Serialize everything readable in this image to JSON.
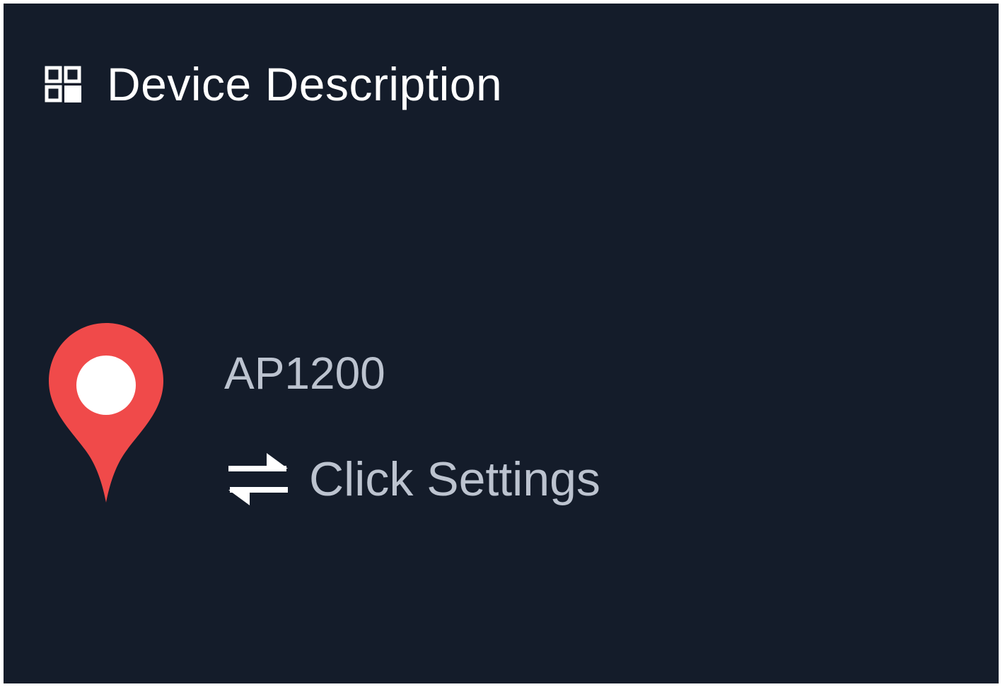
{
  "header": {
    "icon": "grid-icon",
    "title": "Device Description"
  },
  "device": {
    "icon": "map-pin-icon",
    "name": "AP1200",
    "settings_icon": "swap-arrows-icon",
    "settings_label": "Click Settings"
  },
  "colors": {
    "background": "#141c2a",
    "title_text": "#ffffff",
    "secondary_text": "#bcc3cf",
    "pin_red": "#f04a4a",
    "pin_center": "#ffffff"
  }
}
